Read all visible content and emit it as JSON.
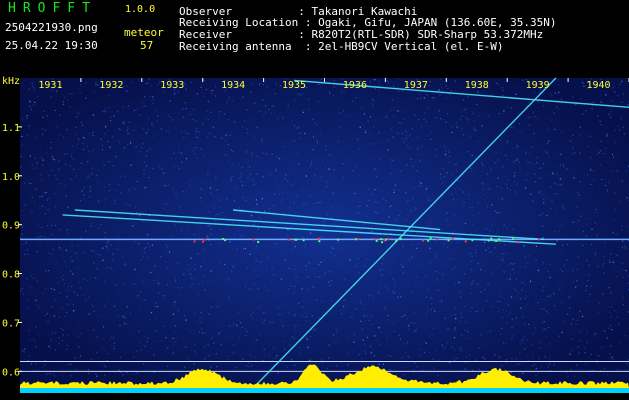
{
  "header": {
    "app_title": "HROFFT",
    "app_version": "1.0.0",
    "file_name": "2504221930.png",
    "date_time": "25.04.22 19:30",
    "meteor_label": "meteor",
    "meteor_count": "57",
    "info_lines": [
      "Observer          : Takanori Kawachi",
      "Receiving Location : Ogaki, Gifu, JAPAN (136.60E, 35.35N)",
      "Receiver          : R820T2(RTL-SDR) SDR-Sharp 53.372MHz",
      "Receiving antenna  : 2el-HB9CV Vertical (el. E-W)"
    ]
  },
  "chart_data": {
    "type": "heatmap",
    "y_unit_label": "kHz",
    "x_ticks": [
      "1931",
      "1932",
      "1933",
      "1934",
      "1935",
      "1936",
      "1937",
      "1938",
      "1939",
      "1940"
    ],
    "y_ticks": [
      "1.1",
      "1.0",
      "0.9",
      "0.8",
      "0.7",
      "0.6"
    ],
    "y_tick_values": [
      1.1,
      1.0,
      0.9,
      0.8,
      0.7,
      0.6
    ],
    "x_range": [
      1930,
      1940
    ],
    "y_range": [
      0.57,
      1.2
    ],
    "carrier_khz": 0.87,
    "lower_lines_khz": [
      0.62,
      0.6
    ],
    "colors": {
      "noise": "#0a1a6e",
      "noise_light": "#2d50c8",
      "carrier": "#6fa8ff",
      "trail": "#4df0ff",
      "trail_hot": "#ff3050",
      "tick_label": "#ffff33",
      "level_fill": "#ffee00",
      "level_base": "#00d2ff"
    },
    "trails": [
      {
        "x1": 1930.9,
        "y1": 0.93,
        "x2": 1938.6,
        "y2": 0.87
      },
      {
        "x1": 1930.7,
        "y1": 0.92,
        "x2": 1938.8,
        "y2": 0.86
      },
      {
        "x1": 1933.5,
        "y1": 0.93,
        "x2": 1936.9,
        "y2": 0.89
      },
      {
        "x1": 1934.5,
        "y1": 1.195,
        "x2": 1940.0,
        "y2": 1.14
      },
      {
        "x1": 1933.9,
        "y1": 0.575,
        "x2": 1938.8,
        "y2": 1.2
      }
    ]
  }
}
